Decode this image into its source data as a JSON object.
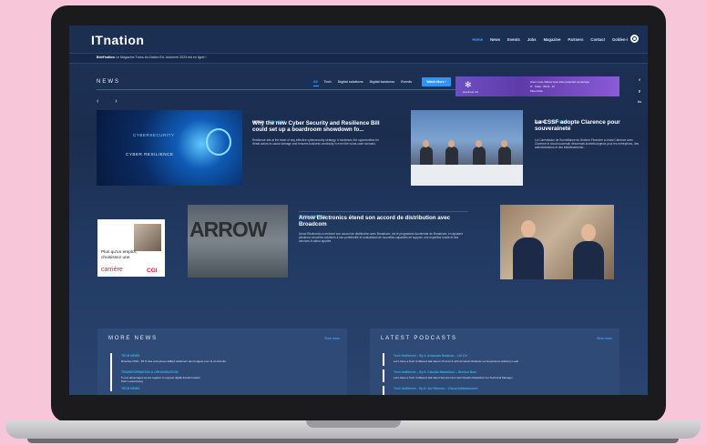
{
  "header": {
    "logo": "ITnation",
    "menu": [
      "Home",
      "News",
      "Events",
      "Jobs",
      "Magazine",
      "Partners",
      "Contact",
      "Golden-i"
    ]
  },
  "ticker": {
    "label": "Brief'nation",
    "text": "– Le Magazine Trans-for-Nation Ed. Automne 2024 est en ligne !"
  },
  "news": {
    "title": "NEWS",
    "tabs": [
      "All",
      "Tech",
      "Digital solutions",
      "Digital business",
      "Events"
    ],
    "more_button": "Watch More ›",
    "arrows": "‹ ›"
  },
  "ad_banner": {
    "brand": "proximus nxt",
    "line1": "Avec nous, libérez tout votre potentiel numérique",
    "line2": "IT · Data · Work · AI",
    "cta": "Plus d'info"
  },
  "social": [
    "f",
    "y",
    "in"
  ],
  "article1": {
    "image_text1": "CYBERSECURITY",
    "image_text2": "CYBER RESILIENCE",
    "date": "24/10/24",
    "category": "TECH NEWS",
    "title": "Why the new Cyber Security and Resilience Bill could set up a boardroom showdown fo...",
    "excerpt": "Resilience sits at the heart of any effective cybersecurity strategy. It minimises the opportunities for threat actors to cause damage and ensures business continuity in even the worst-case scenario."
  },
  "article3": {
    "date": "22/10/24",
    "category": "TECH NEWS",
    "title": "La CSSF adopte Clarence pour souveraineté",
    "excerpt": "La Commission de Surveillance du Secteur Financier a choisi Clarence avec Clarence le cloud souverain désormais luxembourgeois pour les entreprises, des administrations et des établissements..."
  },
  "ad_cgi": {
    "text": "Plus qu'un emploi, choisissez une",
    "highlight": "carrière",
    "brand": "CGI"
  },
  "article_arrow": {
    "image_text": "ARROW",
    "category": "DIGITAL BUSINESS",
    "title": "Arrow Electronics étend son accord de distribution avec Broadcom",
    "excerpt": "Arrow Electronics a renforcé son accord de distribution avec Broadcom, via le programme Accelerate de Broadcom, en ajoutant plusieurs nouvelles solutions à son portefeuille et mutualisant de nouvelles capacités de support, une expertise locale et des services à valeur ajoutée."
  },
  "more_news": {
    "title": "MORE NEWS",
    "view_more": "View more",
    "items": [
      {
        "cat": "TECH NEWS",
        "text": "Directive NIS2 : 38 % des entreprises EMEA réallouent des budgets pour la conformité"
      },
      {
        "cat": "TRANSFORMATION & ORGANISATION",
        "text": "5 new advantages as tax register to support digital transformation"
      },
      {
        "cat": "TECH NEWS",
        "text": ""
      }
    ],
    "sub_text": "PwC Luxembourg"
  },
  "podcasts": {
    "title": "LATEST PODCASTS",
    "view_more": "View more",
    "items": [
      {
        "cat": "Tech Unfiltered – Ep 4. Armando Rolando – UX CX",
        "text": "Let's have a Tech Unfiltered talk about UX and UI with Armando Rolando our Experience Advisory Lead"
      },
      {
        "cat": "Tech Unfiltered – Ep 5. Claudio Mastelluci – Service Now",
        "text": "Let's have a Tech Unfiltered talk about Service Now with Claudio Mastelluci our Technical Manager"
      },
      {
        "cat": "Tech Unfiltered – Ep 6. Joe Moreno – Cloud Infrastructure",
        "text": ""
      }
    ]
  }
}
